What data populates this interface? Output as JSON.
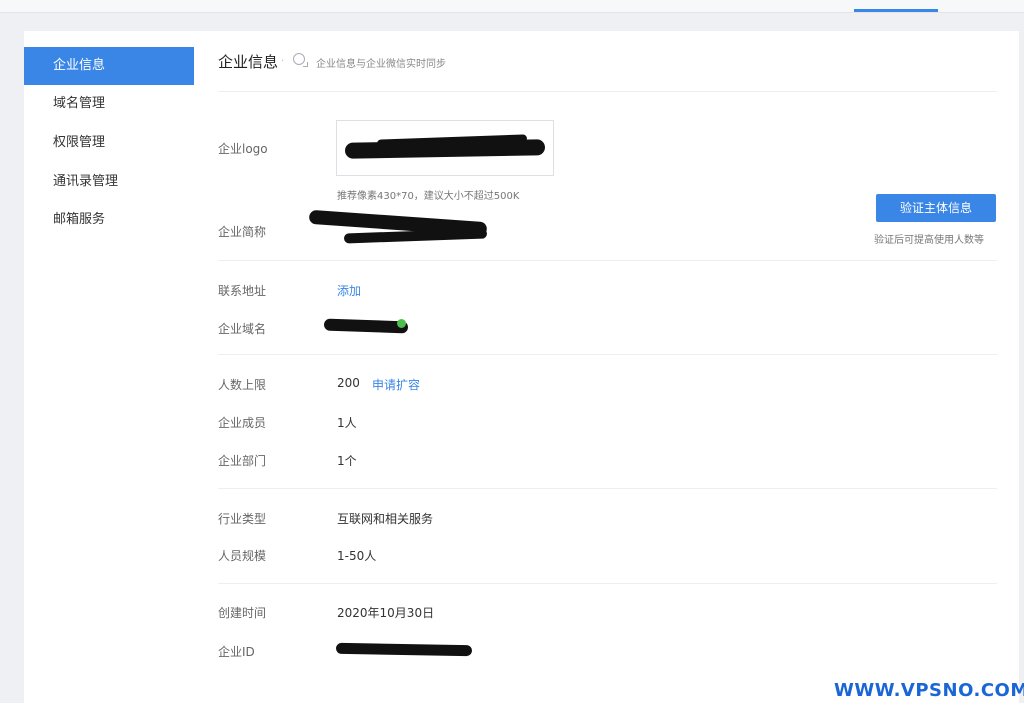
{
  "sidebar": {
    "items": [
      {
        "label": "企业信息",
        "active": true
      },
      {
        "label": "域名管理",
        "active": false
      },
      {
        "label": "权限管理",
        "active": false
      },
      {
        "label": "通讯录管理",
        "active": false
      },
      {
        "label": "邮箱服务",
        "active": false
      }
    ]
  },
  "header": {
    "title": "企业信息",
    "separator": "·",
    "subtitle": "企业信息与企业微信实时同步"
  },
  "fields": {
    "logo": {
      "label": "企业logo",
      "hint": "推荐像素430*70，建议大小不超过500K"
    },
    "short_name": {
      "label": "企业简称"
    },
    "address": {
      "label": "联系地址",
      "action": "添加"
    },
    "domain": {
      "label": "企业域名"
    },
    "member_limit": {
      "label": "人数上限",
      "value": "200",
      "action": "申请扩容"
    },
    "members": {
      "label": "企业成员",
      "value": "1人"
    },
    "departments": {
      "label": "企业部门",
      "value": "1个"
    },
    "industry": {
      "label": "行业类型",
      "value": "互联网和相关服务"
    },
    "scale": {
      "label": "人员规模",
      "value": "1-50人"
    },
    "created": {
      "label": "创建时间",
      "value": "2020年10月30日"
    },
    "corp_id": {
      "label": "企业ID"
    }
  },
  "verify": {
    "button_label": "验证主体信息",
    "hint": "验证后可提高使用人数等"
  },
  "watermark": "WWW.VPSNO.COM",
  "colors": {
    "accent": "#3a86e6",
    "watermark": "#1a66d6"
  }
}
